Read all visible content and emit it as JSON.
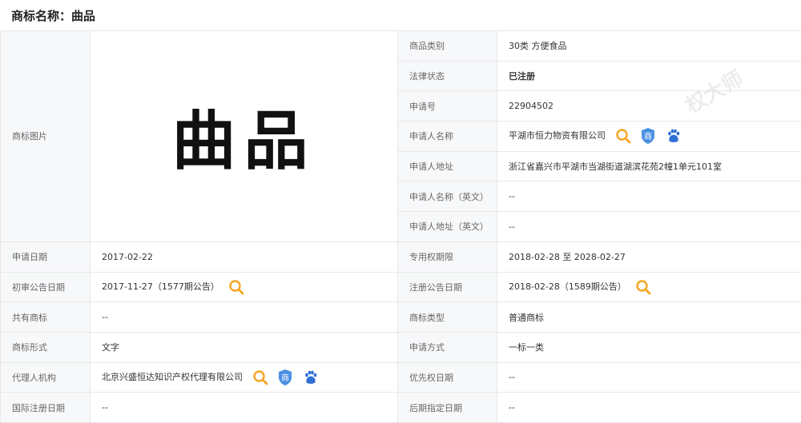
{
  "header": {
    "title": "商标名称：曲品"
  },
  "trademark_image_text": "曲品",
  "watermark": "权大师",
  "labels": {
    "category": "商品类别",
    "legal_status": "法律状态",
    "reg_no": "申请号",
    "applicant": "申请人名称",
    "address": "申请人地址",
    "applicant_en": "申请人名称（英文）",
    "address_en": "申请人地址（英文）",
    "image": "商标图片",
    "apply_date": "申请日期",
    "exclusive_period": "专用权期限",
    "prelim_date": "初审公告日期",
    "reg_announce_date": "注册公告日期",
    "shared": "共有商标",
    "tm_type": "商标类型",
    "tm_form": "商标形式",
    "apply_method": "申请方式",
    "agent": "代理人机构",
    "priority_date": "优先权日期",
    "intl_reg_date": "国际注册日期",
    "later_date": "后期指定日期"
  },
  "values": {
    "category": "30类 方便食品",
    "legal_status": "已注册",
    "reg_no": "22904502",
    "applicant": "平湖市恒力物资有限公司",
    "address": "浙江省嘉兴市平湖市当湖街道湖滨花苑2幢1单元101室",
    "applicant_en": "--",
    "address_en": "--",
    "apply_date": "2017-02-22",
    "exclusive_period": "2018-02-28 至 2028-02-27",
    "prelim_date": "2017-11-27（1577期公告）",
    "reg_announce_date": "2018-02-28（1589期公告）",
    "shared": "--",
    "tm_type": "普通商标",
    "tm_form": "文字",
    "apply_method": "一标一类",
    "agent": "北京兴盛恒达知识产权代理有限公司",
    "priority_date": "--",
    "intl_reg_date": "--",
    "later_date": "--"
  },
  "colors": {
    "status": "#f07c00",
    "search_icon": "#f5a623",
    "shang_icon": "#4a90e2",
    "baidu_icon": "#2f6fd6"
  },
  "icons": {
    "search": "search-icon",
    "shang": "shang-badge-icon",
    "baidu": "baidu-paw-icon"
  },
  "shang_badge_text": "商"
}
